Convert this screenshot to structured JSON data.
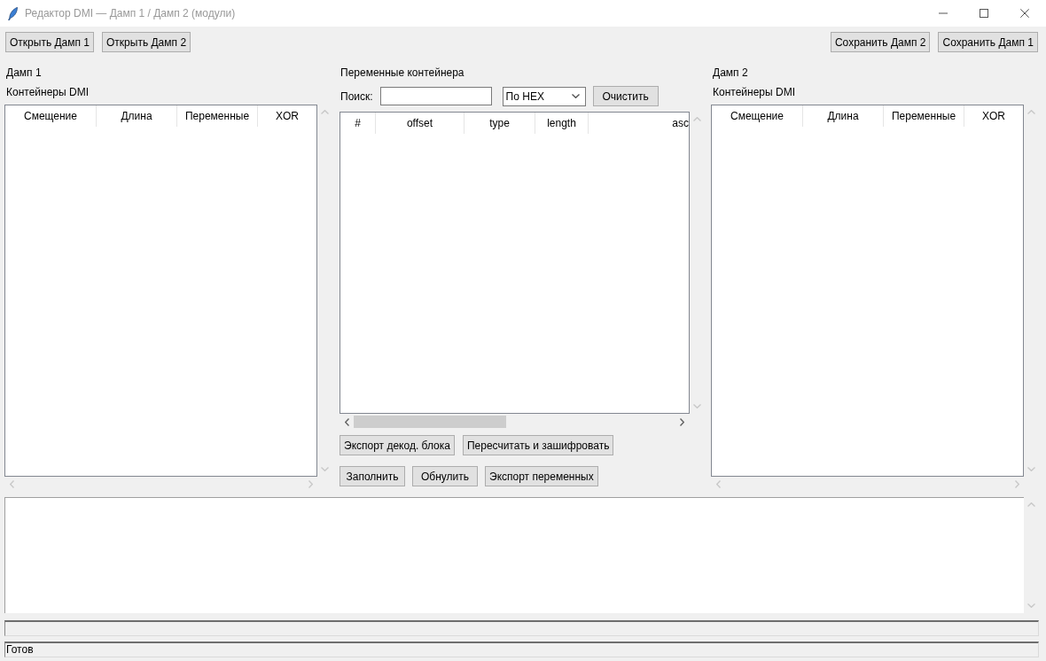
{
  "window": {
    "title": "Редактор DMI — Дамп 1 / Дамп 2 (модули)"
  },
  "toolbar": {
    "left_buttons": [
      "Открыть Дамп 1",
      "Открыть Дамп 2"
    ],
    "right_buttons": [
      "Сохранить Дамп 2",
      "Сохранить Дамп 1"
    ]
  },
  "dump_1": {
    "title": "Дамп 1",
    "subtitle": "Контейнеры DMI",
    "columns": [
      "Смещение",
      "Длина",
      "Переменные",
      "XOR"
    ]
  },
  "variables": {
    "title": "Переменные контейнера",
    "search": {
      "label": "Поиск:"
    },
    "search_mode": {
      "value": "По HEX"
    },
    "clear_button": "Очистить",
    "columns": [
      "#",
      "offset",
      "type",
      "length",
      "asc"
    ],
    "block_buttons": [
      "Экспорт декод. блока",
      "Пересчитать и зашифровать"
    ],
    "variable_buttons": [
      "Заполнить",
      "Обнулить",
      "Экспорт переменных"
    ]
  },
  "dump_2": {
    "title": "Дамп 2",
    "subtitle": "Контейнеры DMI",
    "columns": [
      "Смещение",
      "Длина",
      "Переменные",
      "XOR"
    ]
  },
  "progress": {
    "level": 0
  },
  "status_bar": {
    "text": "Готов"
  }
}
